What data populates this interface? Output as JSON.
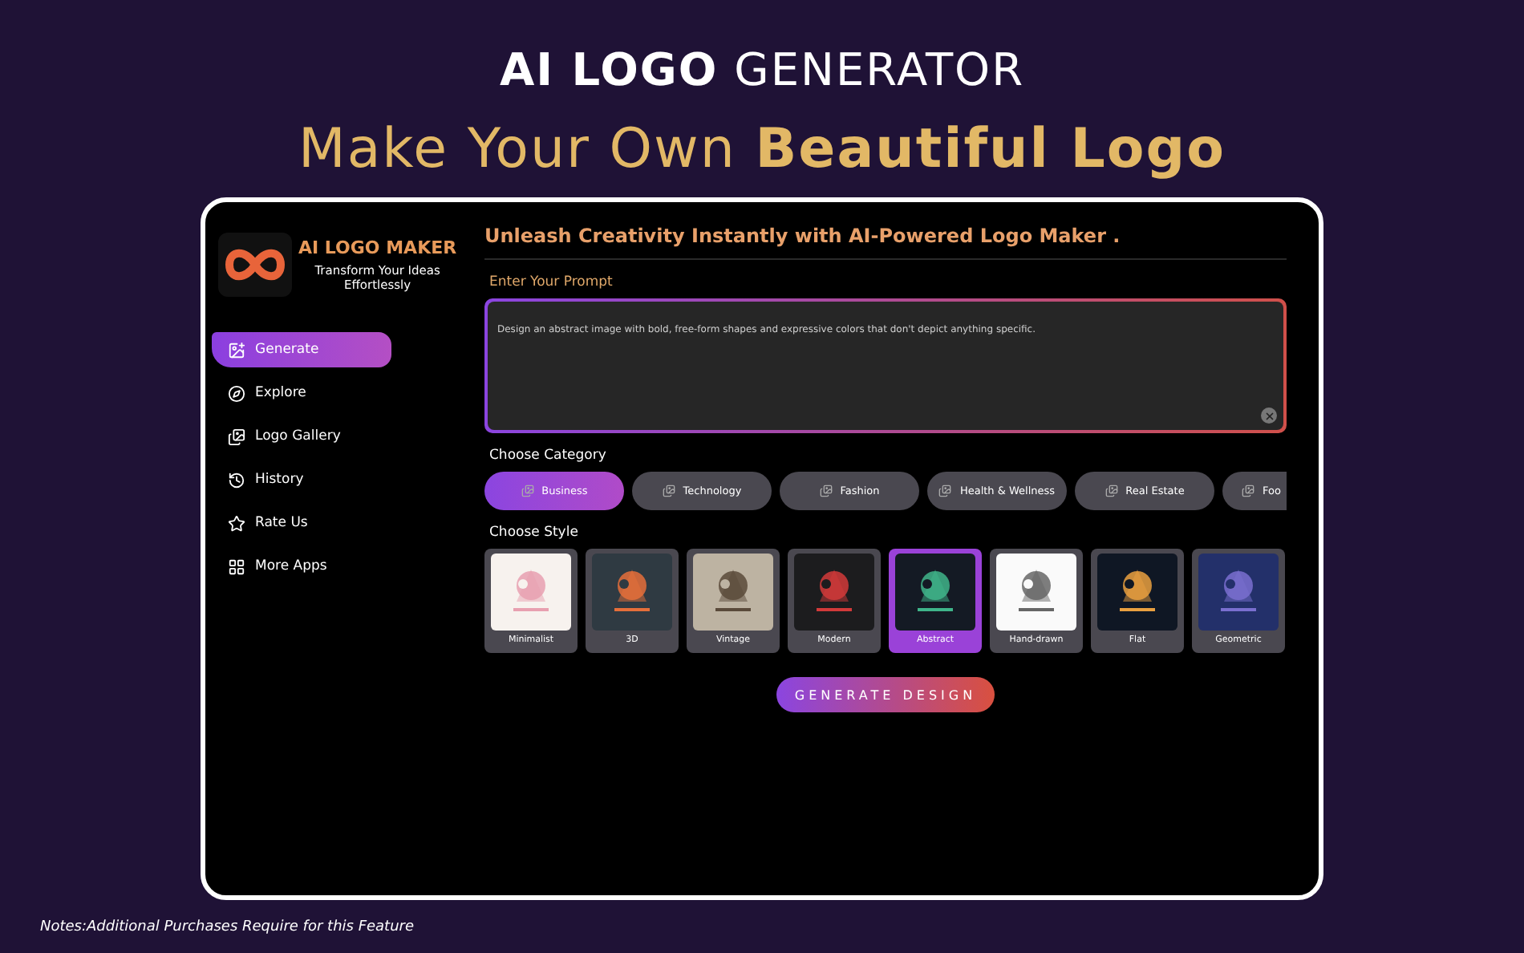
{
  "headline": "**AI LOGO** GENERATOR",
  "subheadline": "Make Your Own **Beautiful Logo**",
  "app": {
    "name": "AI LOGO MAKER",
    "tagline": "Transform Your Ideas Effortlessly"
  },
  "sidebar": {
    "items": [
      {
        "label": "Generate",
        "selected": true
      },
      {
        "label": "Explore",
        "selected": false
      },
      {
        "label": "Logo Gallery",
        "selected": false
      },
      {
        "label": "History",
        "selected": false
      },
      {
        "label": "Rate Us",
        "selected": false
      },
      {
        "label": "More Apps",
        "selected": false
      }
    ]
  },
  "main": {
    "heading": "Unleash Creativity Instantly with AI-Powered Logo Maker .",
    "prompt_label": "Enter Your Prompt",
    "prompt_value": "Design an abstract image with bold, free-form shapes and expressive colors that don't depict anything specific.",
    "category_label": "Choose Category",
    "categories": [
      {
        "label": "Business",
        "selected": true
      },
      {
        "label": "Technology",
        "selected": false
      },
      {
        "label": "Fashion",
        "selected": false
      },
      {
        "label": "Health & Wellness",
        "selected": false
      },
      {
        "label": "Real Estate",
        "selected": false
      },
      {
        "label": "Foo",
        "selected": false
      }
    ],
    "style_label": "Choose Style",
    "styles": [
      {
        "label": "Minimalist",
        "kind": "picture",
        "selected": false
      },
      {
        "label": "3D",
        "kind": "picture",
        "selected": false
      },
      {
        "label": "Vintage",
        "kind": "picture",
        "selected": false
      },
      {
        "label": "Modern",
        "kind": "picture",
        "selected": false
      },
      {
        "label": "Abstract",
        "kind": "picture",
        "selected": true
      },
      {
        "label": "Hand-drawn",
        "kind": "picture",
        "selected": false
      },
      {
        "label": "Flat",
        "kind": "picture",
        "selected": false
      },
      {
        "label": "Geometric",
        "kind": "picture",
        "selected": false
      }
    ],
    "generate_button": "GENERATE DESIGN"
  },
  "note": "Notes:Additional Purchases Require for this Feature"
}
